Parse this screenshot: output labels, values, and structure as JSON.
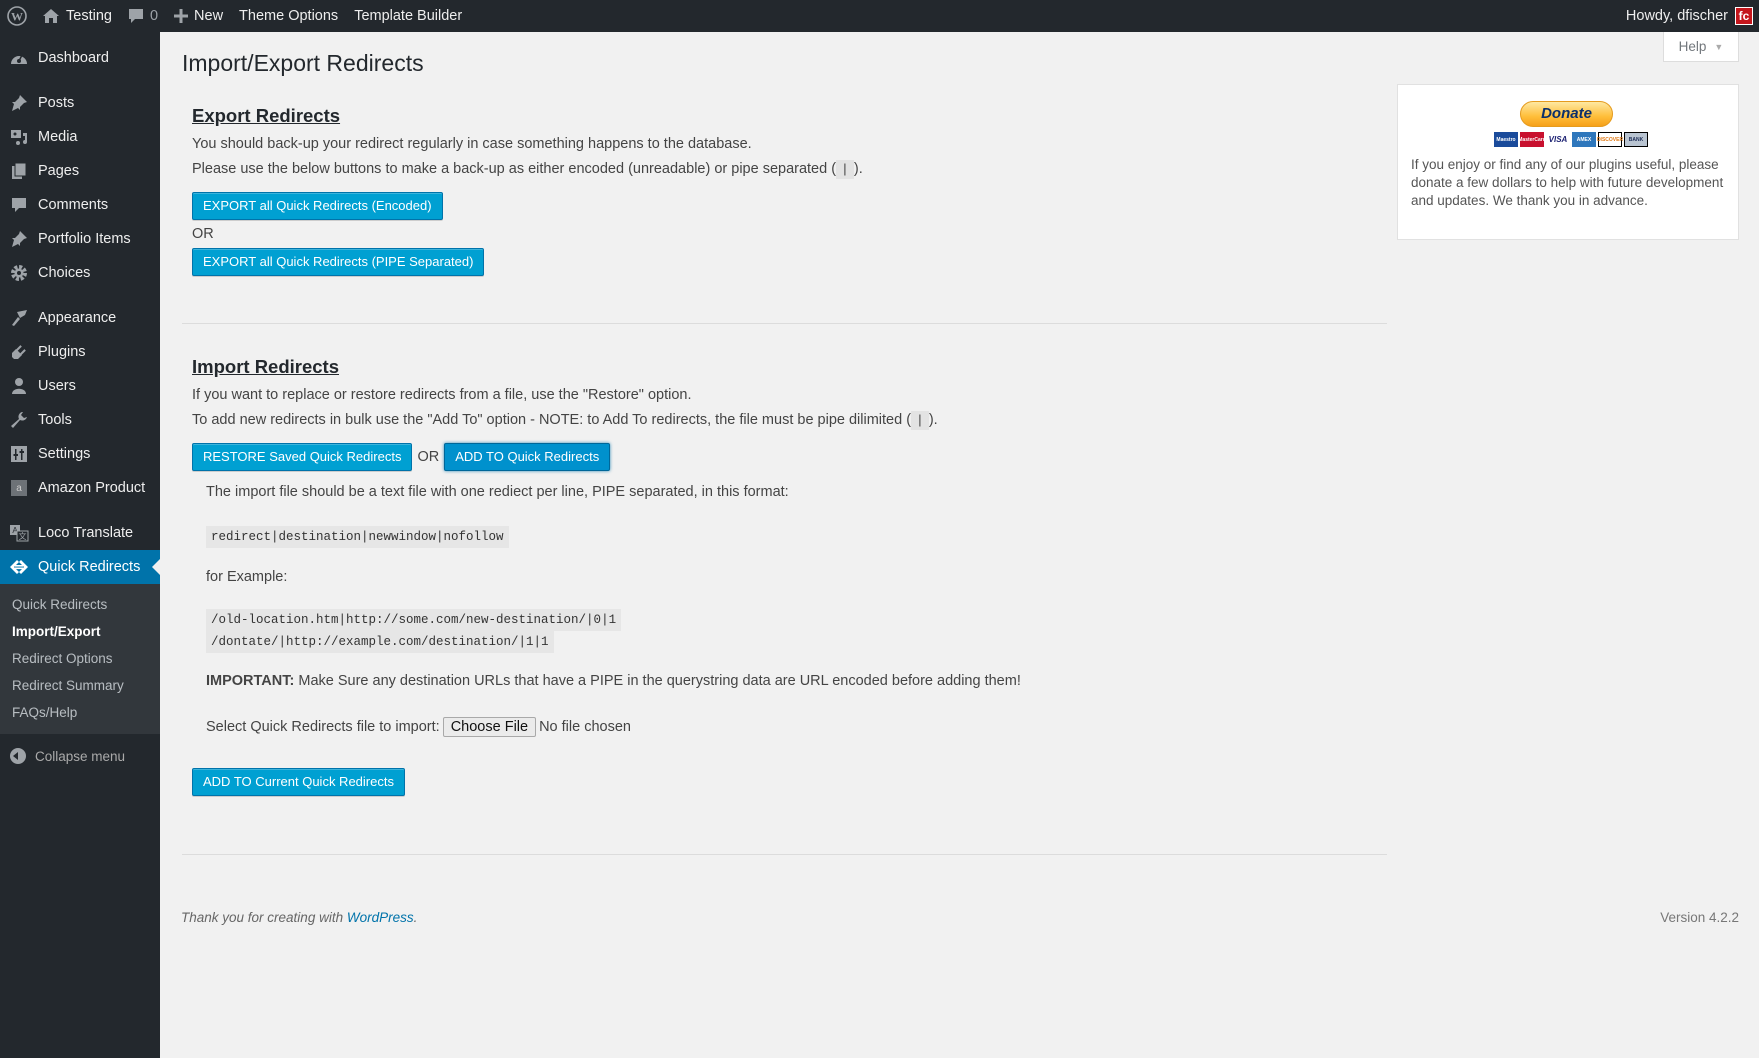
{
  "adminbar": {
    "site_name": "Testing",
    "comments_count": "0",
    "new_label": "New",
    "theme_options_label": "Theme Options",
    "template_builder_label": "Template Builder",
    "howdy": "Howdy, dfischer",
    "avatar_text": "fc"
  },
  "sidebar": {
    "items": [
      {
        "label": "Dashboard",
        "icon": "dashboard-icon"
      },
      {
        "label": "Posts",
        "icon": "pushpin-icon"
      },
      {
        "label": "Media",
        "icon": "media-icon"
      },
      {
        "label": "Pages",
        "icon": "pages-icon"
      },
      {
        "label": "Comments",
        "icon": "comment-icon"
      },
      {
        "label": "Portfolio Items",
        "icon": "pushpin-icon"
      },
      {
        "label": "Choices",
        "icon": "gear-icon"
      },
      {
        "label": "Appearance",
        "icon": "paintbrush-icon"
      },
      {
        "label": "Plugins",
        "icon": "plug-icon"
      },
      {
        "label": "Users",
        "icon": "user-icon"
      },
      {
        "label": "Tools",
        "icon": "wrench-icon"
      },
      {
        "label": "Settings",
        "icon": "sliders-icon"
      },
      {
        "label": "Amazon Product",
        "icon": "amazon-icon"
      },
      {
        "label": "Loco Translate",
        "icon": "translate-icon"
      },
      {
        "label": "Quick Redirects",
        "icon": "redirect-icon"
      }
    ],
    "submenu": [
      {
        "label": "Quick Redirects"
      },
      {
        "label": "Import/Export"
      },
      {
        "label": "Redirect Options"
      },
      {
        "label": "Redirect Summary"
      },
      {
        "label": "FAQs/Help"
      }
    ],
    "collapse_label": "Collapse menu"
  },
  "help_tab": "Help",
  "page_title": "Import/Export Redirects",
  "export": {
    "heading": "Export Redirects",
    "line1": "You should back-up your redirect regularly in case something happens to the database.",
    "line2_pre": "Please use the below buttons to make a back-up as either encoded (unreadable) or pipe separated (",
    "pipe": "|",
    "line2_post": ").",
    "btn_encoded": "EXPORT all Quick Redirects (Encoded)",
    "or": "OR",
    "btn_pipe": "EXPORT all Quick Redirects (PIPE Separated)"
  },
  "import": {
    "heading": "Import Redirects",
    "line1": "If you want to replace or restore redirects from a file, use the \"Restore\" option.",
    "line2_pre": "To add new redirects in bulk use the \"Add To\" option - NOTE: to Add To redirects, the file must be pipe dilimited (",
    "pipe": "|",
    "line2_post": ").",
    "btn_restore": "RESTORE Saved Quick Redirects",
    "or": "OR",
    "btn_add": "ADD TO Quick Redirects",
    "format_intro": "The import file should be a text file with one rediect per line, PIPE separated, in this format:",
    "format_code": "redirect|destination|newwindow|nofollow",
    "example_label": "for Example:",
    "example_lines": [
      "/old-location.htm|http://some.com/new-destination/|0|1",
      "/dontate/|http://example.com/destination/|1|1"
    ],
    "important_label": "IMPORTANT:",
    "important_text": " Make Sure any destination URLs that have a PIPE in the querystring data are URL encoded before adding them!",
    "file_label": "Select Quick Redirects file to import:",
    "file_button": "Choose File",
    "file_status": "No file chosen",
    "btn_add_current": "ADD TO Current Quick Redirects"
  },
  "donate": {
    "button": "Donate",
    "cards": [
      "Maestro",
      "MasterCard",
      "VISA",
      "AMEX",
      "DISCOVER",
      "BANK"
    ],
    "text": "If you enjoy or find any of our plugins useful, please donate a few dollars to help with future development and updates. We thank you in advance."
  },
  "footer": {
    "thanks_pre": "Thank you for creating with ",
    "wordpress_link": "WordPress",
    "thanks_post": ".",
    "version": "Version 4.2.2"
  }
}
